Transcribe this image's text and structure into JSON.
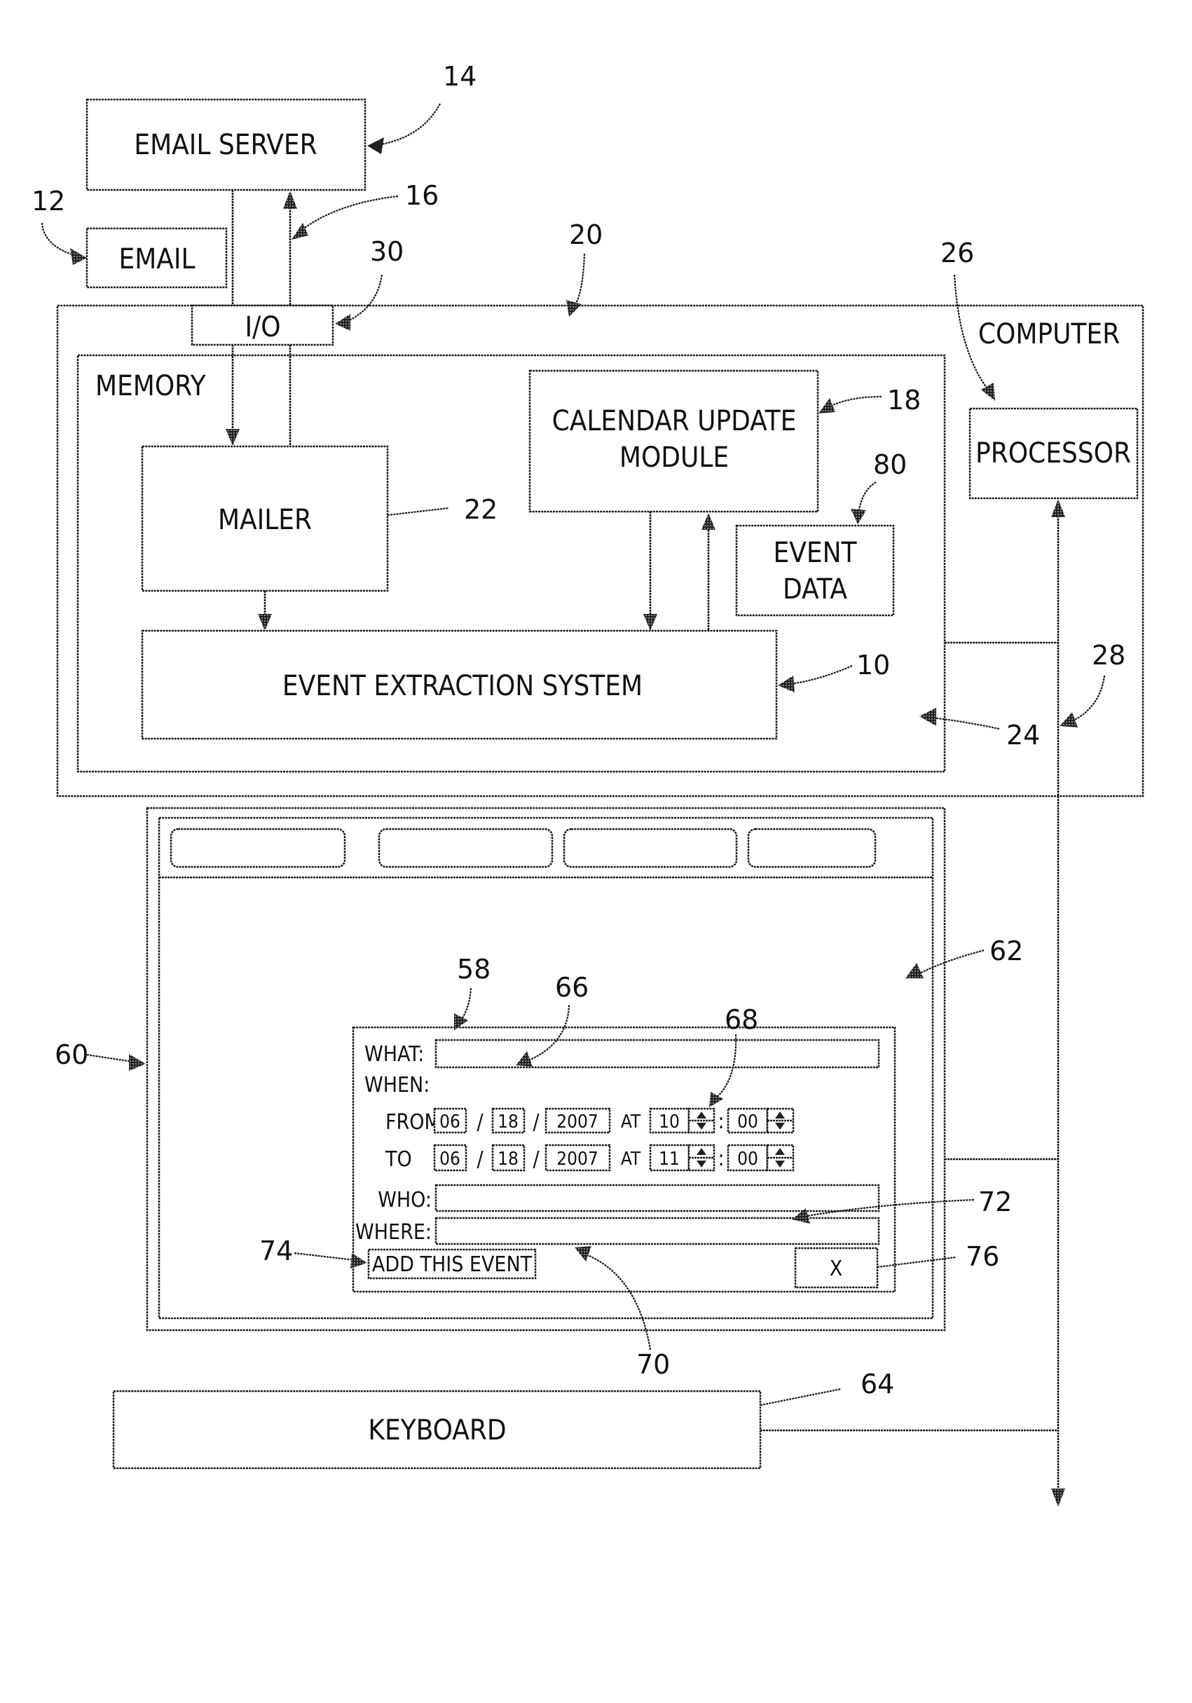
{
  "figure": {
    "blocks": {
      "email_server": "EMAIL SERVER",
      "email": "EMAIL",
      "io": "I/O",
      "computer": "COMPUTER",
      "memory": "MEMORY",
      "calendar_update_line1": "CALENDAR UPDATE",
      "calendar_update_line2": "MODULE",
      "mailer": "MAILER",
      "event_data_line1": "EVENT",
      "event_data_line2": "DATA",
      "event_extraction": "EVENT  EXTRACTION SYSTEM",
      "processor": "PROCESSOR",
      "keyboard": "KEYBOARD"
    },
    "refs": {
      "r14": "14",
      "r12": "12",
      "r16": "16",
      "r30": "30",
      "r20": "20",
      "r26": "26",
      "r18": "18",
      "r22": "22",
      "r80": "80",
      "r10": "10",
      "r28": "28",
      "r24": "24",
      "r62": "62",
      "r60": "60",
      "r58": "58",
      "r66": "66",
      "r68": "68",
      "r72": "72",
      "r74": "74",
      "r76": "76",
      "r70": "70",
      "r64": "64"
    },
    "display": {
      "tabs": [
        "",
        "",
        "",
        ""
      ]
    },
    "dialog": {
      "what_label": "WHAT:",
      "what_value": "",
      "when_label": "WHEN:",
      "from_label": "FROM",
      "to_label": "TO",
      "at_label": "AT",
      "slash": "/",
      "colon": ":",
      "from": {
        "month": "06",
        "day": "18",
        "year": "2007",
        "hour": "10",
        "minute": "00"
      },
      "to": {
        "month": "06",
        "day": "18",
        "year": "2007",
        "hour": "11",
        "minute": "00"
      },
      "who_label": "WHO:",
      "who_value": "",
      "where_label": "WHERE:",
      "where_value": "",
      "add_button": "ADD THIS EVENT",
      "close_button": "X"
    }
  }
}
